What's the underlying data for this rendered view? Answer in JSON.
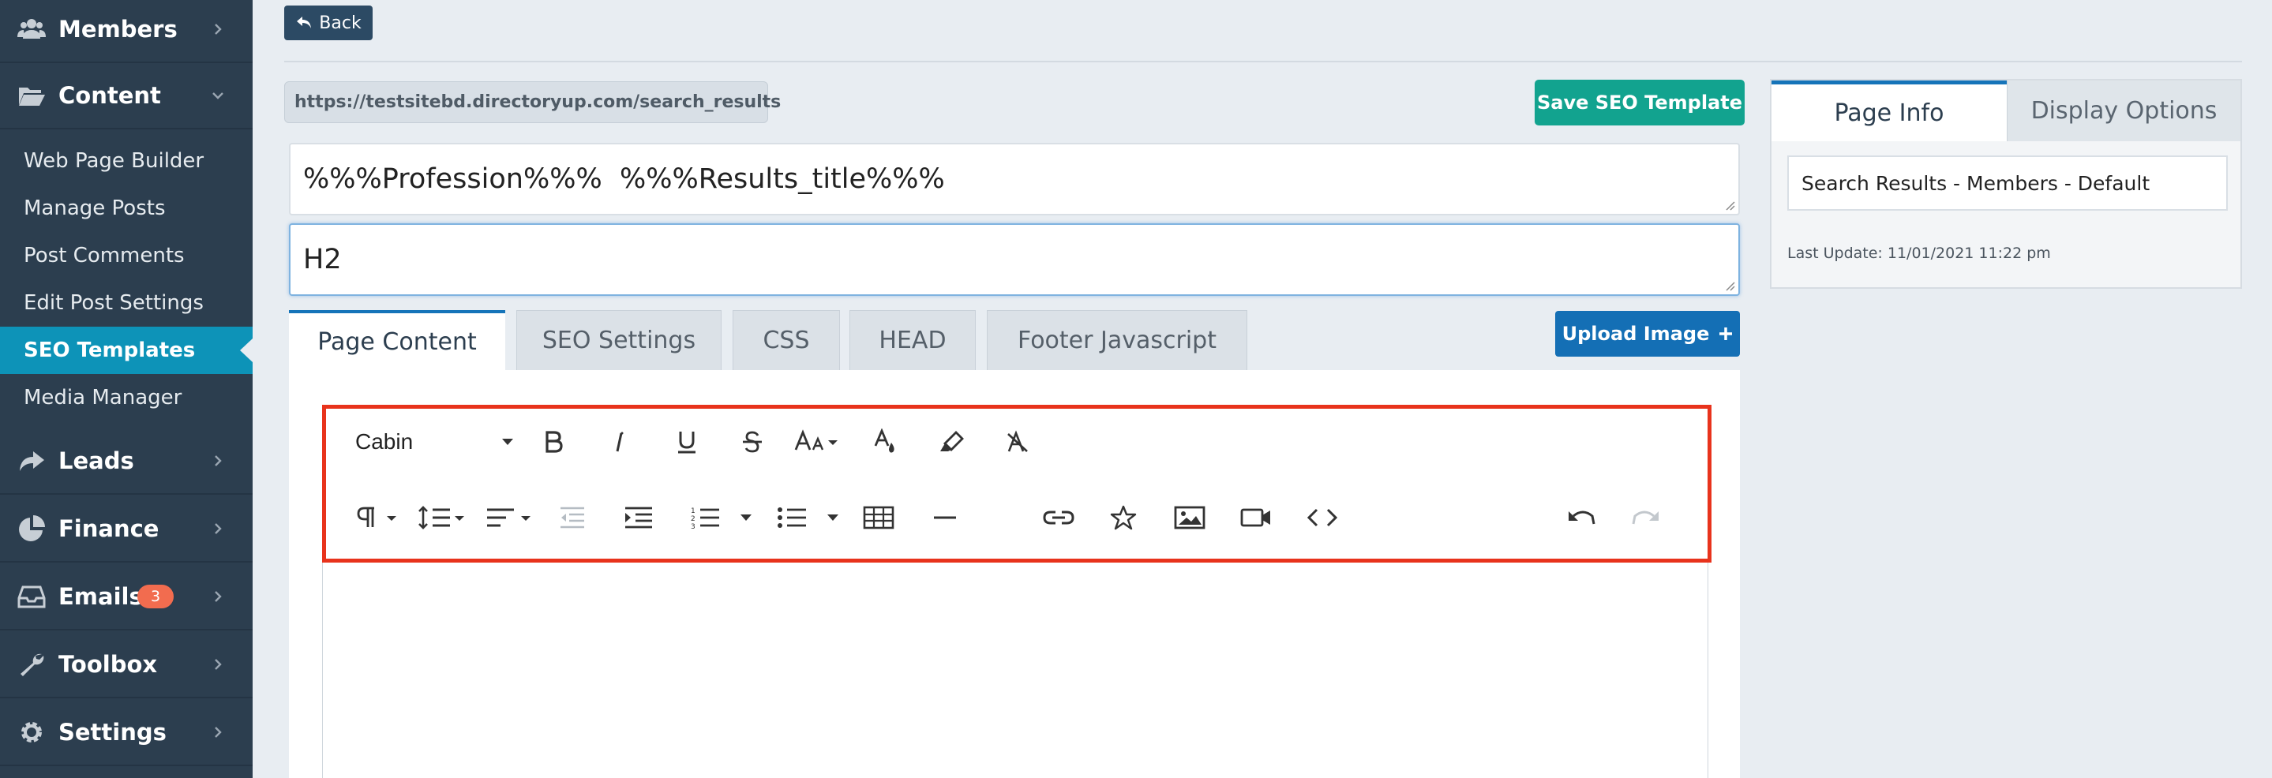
{
  "sidebar": {
    "items": [
      {
        "label": "Members",
        "icon": "users-icon"
      },
      {
        "label": "Content",
        "icon": "folder-open-icon",
        "expanded": true
      },
      {
        "label": "Leads",
        "icon": "share-icon"
      },
      {
        "label": "Finance",
        "icon": "pie-chart-icon"
      },
      {
        "label": "Emails",
        "icon": "inbox-icon",
        "badge": "3"
      },
      {
        "label": "Toolbox",
        "icon": "wrench-icon"
      },
      {
        "label": "Settings",
        "icon": "gear-icon"
      }
    ],
    "content_sub": [
      {
        "label": "Web Page Builder"
      },
      {
        "label": "Manage Posts"
      },
      {
        "label": "Post Comments"
      },
      {
        "label": "Edit Post Settings"
      },
      {
        "label": "SEO Templates",
        "active": true
      },
      {
        "label": "Media Manager"
      }
    ]
  },
  "header": {
    "back_label": "Back",
    "url": "https://testsitebd.directoryup.com/search_results",
    "save_label": "Save SEO Template"
  },
  "fields": {
    "h1_value": "%%%Profession%%%  %%%Results_title%%%",
    "h2_value": "H2"
  },
  "tabs": [
    {
      "label": "Page Content",
      "active": true
    },
    {
      "label": "SEO Settings"
    },
    {
      "label": "CSS"
    },
    {
      "label": "HEAD"
    },
    {
      "label": "Footer Javascript"
    }
  ],
  "upload_label": "Upload Image",
  "editor": {
    "font_name": "Cabin",
    "toolbar_row1": [
      "bold-icon",
      "italic-icon",
      "underline-icon",
      "strikethrough-icon",
      "font-size-icon",
      "font-color-icon",
      "highlight-icon",
      "clear-format-icon"
    ],
    "toolbar_row2": [
      "paragraph-icon",
      "line-height-icon",
      "align-icon",
      "outdent-icon",
      "indent-icon",
      "ordered-list-icon",
      "unordered-list-icon",
      "table-icon",
      "horizontal-rule-icon",
      "link-icon",
      "star-icon",
      "image-icon",
      "video-icon",
      "code-icon",
      "undo-icon",
      "redo-icon"
    ]
  },
  "right_panel": {
    "tabs": [
      {
        "label": "Page Info",
        "active": true
      },
      {
        "label": "Display Options"
      }
    ],
    "page_name": "Search Results - Members - Default",
    "last_update": "Last Update: 11/01/2021 11:22 pm"
  },
  "colors": {
    "sidebar_bg": "#2c3e4f",
    "active_nav": "#0d93b8",
    "save_button": "#12a38f",
    "upload_button": "#146fb5",
    "toolbar_highlight": "#e8331c",
    "badge": "#f26c4f"
  }
}
